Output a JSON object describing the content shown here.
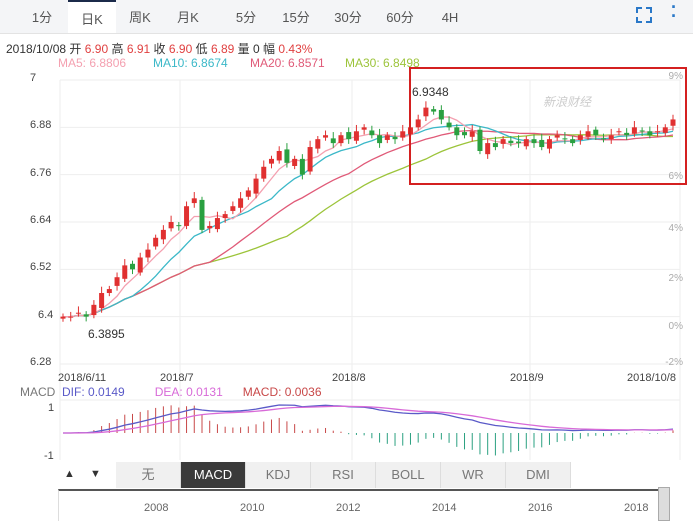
{
  "tabs": [
    "1分",
    "日K",
    "周K",
    "月K",
    "5分",
    "15分",
    "30分",
    "60分",
    "4H"
  ],
  "active_tab": 1,
  "info": {
    "date": "2018/10/08",
    "open_label": "开",
    "open": "6.90",
    "high_label": "高",
    "high": "6.91",
    "close_label": "收",
    "close": "6.90",
    "low_label": "低",
    "low": "6.89",
    "vol_label": "量",
    "vol": "0",
    "chg_label": "幅",
    "chg": "0.43%"
  },
  "ma": {
    "ma5": "MA5: 6.8806",
    "ma10": "MA10: 6.8674",
    "ma20": "MA20: 6.8571",
    "ma30": "MA30: 6.8498"
  },
  "colors": {
    "ma5": "#f4a0b0",
    "ma10": "#3bb8c8",
    "ma20": "#e05a78",
    "ma30": "#9cc43a",
    "up": "#e03030",
    "down": "#2aa040",
    "highlight": "#d42020"
  },
  "y_ticks": [
    "7",
    "6.88",
    "6.76",
    "6.64",
    "6.52",
    "6.4",
    "6.28"
  ],
  "pct_ticks": [
    "9%",
    "6%",
    "4%",
    "2%",
    "0%",
    "-2%"
  ],
  "x_ticks": [
    "2018/6/11",
    "2018/7",
    "2018/8",
    "2018/9",
    "2018/10/8"
  ],
  "annotations": {
    "max": "6.9348",
    "min": "6.3895"
  },
  "watermark": "新浪财经",
  "chart_data": {
    "type": "candlestick",
    "closes": [
      6.4,
      6.4,
      6.41,
      6.4,
      6.43,
      6.46,
      6.47,
      6.5,
      6.53,
      6.52,
      6.55,
      6.57,
      6.6,
      6.62,
      6.64,
      6.63,
      6.68,
      6.7,
      6.62,
      6.63,
      6.65,
      6.66,
      6.68,
      6.7,
      6.72,
      6.75,
      6.78,
      6.8,
      6.82,
      6.79,
      6.8,
      6.76,
      6.83,
      6.85,
      6.86,
      6.84,
      6.86,
      6.85,
      6.87,
      6.88,
      6.86,
      6.84,
      6.86,
      6.85,
      6.87,
      6.88,
      6.9,
      6.93,
      6.92,
      6.9,
      6.88,
      6.86,
      6.86,
      6.87,
      6.82,
      6.84,
      6.83,
      6.85,
      6.84,
      6.84,
      6.85,
      6.84,
      6.83,
      6.85,
      6.86,
      6.85,
      6.84,
      6.86,
      6.87,
      6.86,
      6.85,
      6.86,
      6.87,
      6.86,
      6.88,
      6.87,
      6.86,
      6.87,
      6.88,
      6.9
    ],
    "ylim": [
      6.28,
      7.0
    ]
  },
  "macd": {
    "label": "MACD",
    "dif": "DIF: 0.0149",
    "dea": "DEA: 0.0131",
    "macd": "MACD: 0.0036",
    "ticks": [
      "1",
      "-1"
    ]
  },
  "indicators": [
    "无",
    "MACD",
    "KDJ",
    "RSI",
    "BOLL",
    "WR",
    "DMI"
  ],
  "active_indicator": 1,
  "nav_years": [
    "2008",
    "2010",
    "2012",
    "2014",
    "2016",
    "2018"
  ]
}
